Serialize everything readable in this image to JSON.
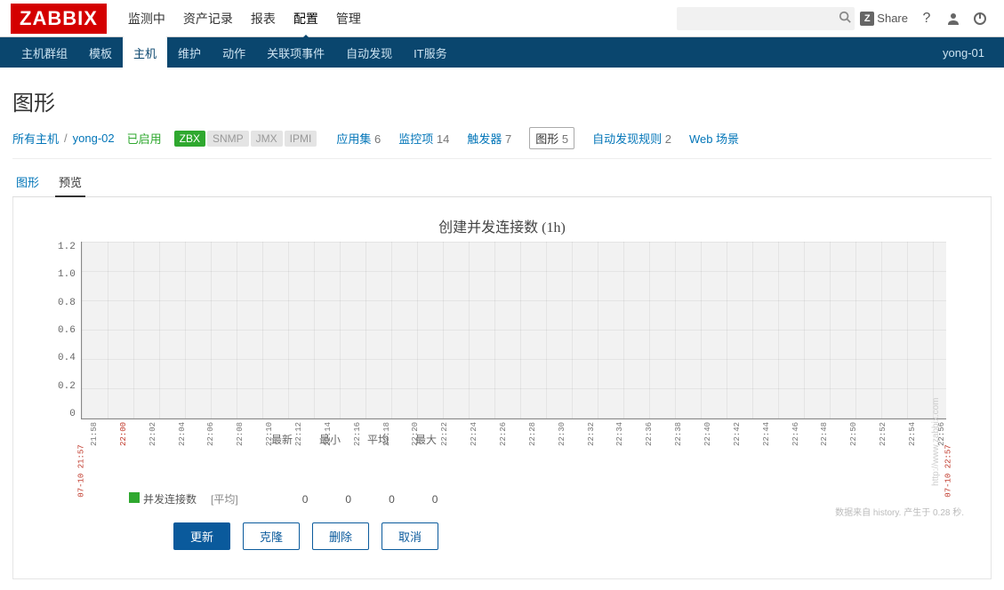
{
  "logo": "ZABBIX",
  "topnav": {
    "items": [
      "监测中",
      "资产记录",
      "报表",
      "配置",
      "管理"
    ],
    "active_index": 3,
    "share_label": "Share",
    "share_prefix": "Z"
  },
  "subnav": {
    "items": [
      "主机群组",
      "模板",
      "主机",
      "维护",
      "动作",
      "关联项事件",
      "自动发现",
      "IT服务"
    ],
    "active_index": 2,
    "right_user": "yong-01"
  },
  "page_title": "图形",
  "breadcrumb": {
    "all_hosts": "所有主机",
    "host": "yong-02",
    "enabled": "已启用",
    "badges": [
      {
        "label": "ZBX",
        "class": "zbx"
      },
      {
        "label": "SNMP",
        "class": "gray"
      },
      {
        "label": "JMX",
        "class": "gray"
      },
      {
        "label": "IPMI",
        "class": "gray"
      }
    ],
    "stats": [
      {
        "label": "应用集",
        "count": "6",
        "active": false
      },
      {
        "label": "监控项",
        "count": "14",
        "active": false
      },
      {
        "label": "触发器",
        "count": "7",
        "active": false
      },
      {
        "label": "图形",
        "count": "5",
        "active": true
      },
      {
        "label": "自动发现规则",
        "count": "2",
        "active": false
      },
      {
        "label": "Web 场景",
        "count": "",
        "active": false
      }
    ]
  },
  "tabs": {
    "items": [
      "图形",
      "预览"
    ],
    "active_index": 1
  },
  "chart_data": {
    "type": "line",
    "title": "创建并发连接数 (1h)",
    "ylabel": "",
    "xlabel": "",
    "ylim": [
      0,
      1.2
    ],
    "yticks": [
      "1.2",
      "1.0",
      "0.8",
      "0.6",
      "0.4",
      "0.2",
      "0"
    ],
    "x_start": "07-10 21:57",
    "x_end": "07-10 22:57",
    "xticks": [
      "21:58",
      "22:00",
      "22:02",
      "22:04",
      "22:06",
      "22:08",
      "22:10",
      "22:12",
      "22:14",
      "22:16",
      "22:18",
      "22:20",
      "22:22",
      "22:24",
      "22:26",
      "22:28",
      "22:30",
      "22:32",
      "22:34",
      "22:36",
      "22:38",
      "22:40",
      "22:42",
      "22:44",
      "22:46",
      "22:48",
      "22:50",
      "22:52",
      "22:54",
      "22:56"
    ],
    "series": [
      {
        "name": "并发连接数",
        "agg": "[平均]",
        "values_flat": 0,
        "color": "#2fa82f"
      }
    ],
    "legend_headers": [
      "最新",
      "最小",
      "平均",
      "最大"
    ],
    "legend_values": [
      "0",
      "0",
      "0",
      "0"
    ]
  },
  "footer_note": "数据来自 history. 产生于 0.28 秒.",
  "watermark": "http://www.zabbix.com",
  "buttons": {
    "update": "更新",
    "clone": "克隆",
    "delete": "删除",
    "cancel": "取消"
  }
}
